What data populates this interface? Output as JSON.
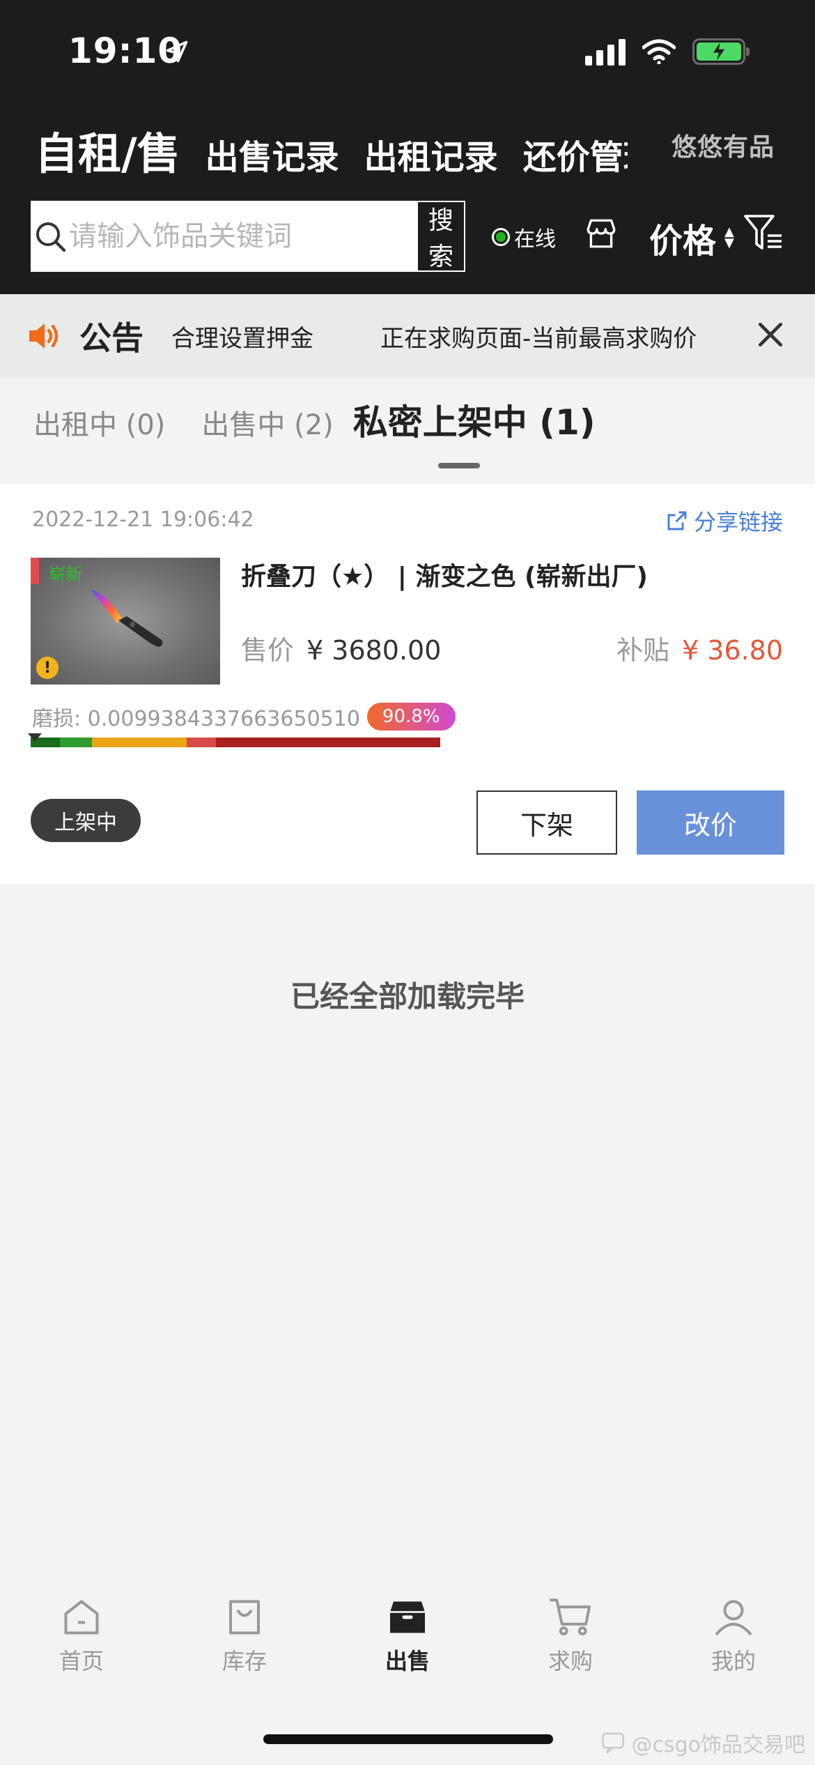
{
  "status_bar": {
    "time": "19:10"
  },
  "header": {
    "tabs": [
      {
        "label": "自租/售"
      },
      {
        "label": "出售记录"
      },
      {
        "label": "出租记录"
      },
      {
        "label": "还价管理"
      }
    ],
    "brand": "悠悠有品"
  },
  "search": {
    "placeholder": "请输入饰品关键词",
    "button_label": "搜索",
    "online_label": "在线",
    "sort_label": "价格"
  },
  "notice": {
    "title": "公告",
    "messages": [
      "合理设置押金",
      "正在求购页面-当前最高求购价"
    ]
  },
  "status_tabs": [
    {
      "label": "出租中 (0)"
    },
    {
      "label": "出售中 (2)"
    },
    {
      "label": "私密上架中 (1)"
    }
  ],
  "item": {
    "date": "2022-12-21 19:06:42",
    "share_label": "分享链接",
    "condition_tag": "崭新",
    "name": "折叠刀（★） | 渐变之色 (崭新出厂)",
    "price_label": "售价",
    "price": "¥ 3680.00",
    "subsidy_label": "补贴",
    "subsidy": "¥ 36.80",
    "wear_label": "磨损: 0.0099384337663650510",
    "wear_percent": "90.8%",
    "wear_value": 0.009938433766365051,
    "status_badge": "上架中",
    "delist_label": "下架",
    "edit_price_label": "改价"
  },
  "list_end": "已经全部加载完毕",
  "bottom_nav": [
    {
      "label": "首页",
      "icon": "home-icon"
    },
    {
      "label": "库存",
      "icon": "bag-icon"
    },
    {
      "label": "出售",
      "icon": "box-icon"
    },
    {
      "label": "求购",
      "icon": "cart-icon"
    },
    {
      "label": "我的",
      "icon": "user-icon"
    }
  ],
  "watermark": "@csgo饰品交易吧",
  "colors": {
    "header_bg": "#1c1c1c",
    "accent_blue": "#6791d8",
    "subsidy_red": "#e2583a",
    "link_blue": "#4a7fd4"
  }
}
